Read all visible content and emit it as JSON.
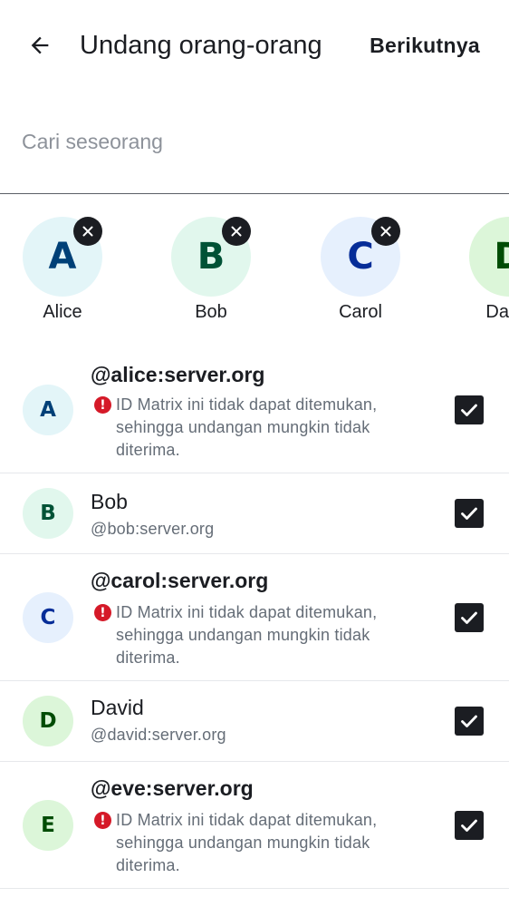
{
  "header": {
    "title": "Undang orang-orang",
    "next_label": "Berikutnya",
    "back_icon": "arrow-left-icon"
  },
  "search": {
    "placeholder": "Cari seseorang",
    "value": ""
  },
  "selected": [
    {
      "initial": "A",
      "name": "Alice",
      "bg": "#e3f5f8",
      "fg": "#004077"
    },
    {
      "initial": "B",
      "name": "Bob",
      "bg": "#e1f7ed",
      "fg": "#005236"
    },
    {
      "initial": "C",
      "name": "Carol",
      "bg": "#e6f0fd",
      "fg": "#062d98"
    },
    {
      "initial": "D",
      "name": "David",
      "bg": "#dcf6d9",
      "fg": "#004c05"
    }
  ],
  "users": [
    {
      "initial": "A",
      "name": "@alice:server.org",
      "unresolved": true,
      "warning": "ID Matrix ini tidak dapat ditemukan, sehingga undangan mungkin tidak diterima.",
      "bg": "#e3f5f8",
      "fg": "#004077",
      "checked": true
    },
    {
      "initial": "B",
      "name": "Bob",
      "id": "@bob:server.org",
      "unresolved": false,
      "bg": "#e1f7ed",
      "fg": "#005236",
      "checked": true
    },
    {
      "initial": "C",
      "name": "@carol:server.org",
      "unresolved": true,
      "warning": "ID Matrix ini tidak dapat ditemukan, sehingga undangan mungkin tidak diterima.",
      "bg": "#e6f0fd",
      "fg": "#062d98",
      "checked": true
    },
    {
      "initial": "D",
      "name": "David",
      "id": "@david:server.org",
      "unresolved": false,
      "bg": "#dcf6d9",
      "fg": "#004c05",
      "checked": true
    },
    {
      "initial": "E",
      "name": "@eve:server.org",
      "unresolved": true,
      "warning": "ID Matrix ini tidak dapat ditemukan, sehingga undangan mungkin tidak diterima.",
      "bg": "#dcf6d9",
      "fg": "#004c05",
      "checked": true
    }
  ]
}
